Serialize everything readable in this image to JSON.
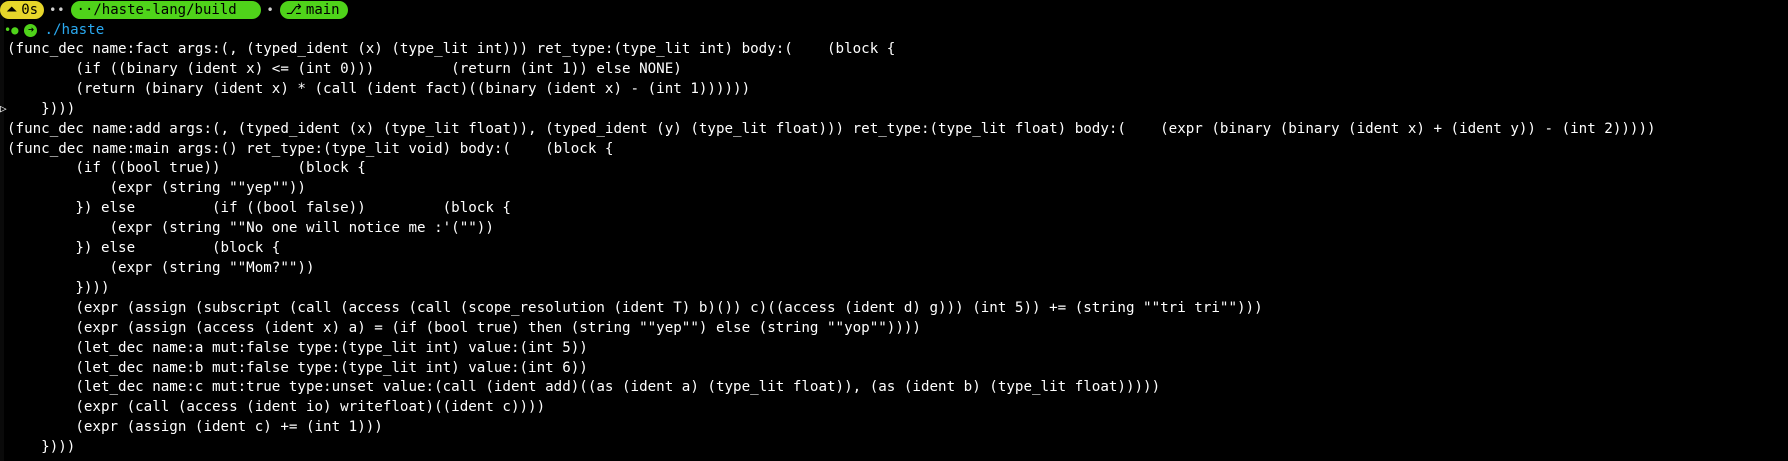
{
  "prompt": {
    "duration": "0s",
    "duration_icon": "triangle-up-icon",
    "path": "··/haste-lang/build",
    "branch": "main",
    "branch_icon": "git-branch-icon"
  },
  "command": {
    "text": "./haste",
    "status_icon": "status-dot-icon",
    "arrow_icon": "arrow-right-icon"
  },
  "output": {
    "lines": [
      "(func_dec name:fact args:(, (typed_ident (x) (type_lit int))) ret_type:(type_lit int) body:(    (block {",
      "        (if ((binary (ident x) <= (int 0)))         (return (int 1)) else NONE)",
      "        (return (binary (ident x) * (call (ident fact)((binary (ident x) - (int 1))))))",
      "    })))",
      "(func_dec name:add args:(, (typed_ident (x) (type_lit float)), (typed_ident (y) (type_lit float))) ret_type:(type_lit float) body:(    (expr (binary (binary (ident x) + (ident y)) - (int 2)))))",
      "(func_dec name:main args:() ret_type:(type_lit void) body:(    (block {",
      "        (if ((bool true))         (block {",
      "            (expr (string \"\"yep\"\"))",
      "        }) else         (if ((bool false))         (block {",
      "            (expr (string \"\"No one will notice me :'(\"\"))",
      "        }) else         (block {",
      "            (expr (string \"\"Mom?\"\"))",
      "        })))",
      "        (expr (assign (subscript (call (access (call (scope_resolution (ident T) b)()) c)((access (ident d) g))) (int 5)) += (string \"\"tri tri\"\")))",
      "        (expr (assign (access (ident x) a) = (if (bool true) then (string \"\"yep\"\") else (string \"\"yop\"\"))))",
      "        (let_dec name:a mut:false type:(type_lit int) value:(int 5))",
      "        (let_dec name:b mut:false type:(type_lit int) value:(int 6))",
      "        (let_dec name:c mut:true type:unset value:(call (ident add)((as (ident a) (type_lit float)), (as (ident b) (type_lit float)))))",
      "        (expr (call (access (ident io) writefloat)((ident c))))",
      "        (expr (assign (ident c) += (int 1)))",
      "    })))"
    ]
  },
  "colors": {
    "background": "#000000",
    "foreground": "#ffffff",
    "pill_yellow": "#e6d62a",
    "pill_green": "#4fd31a",
    "command_blue": "#2aa9f0"
  }
}
